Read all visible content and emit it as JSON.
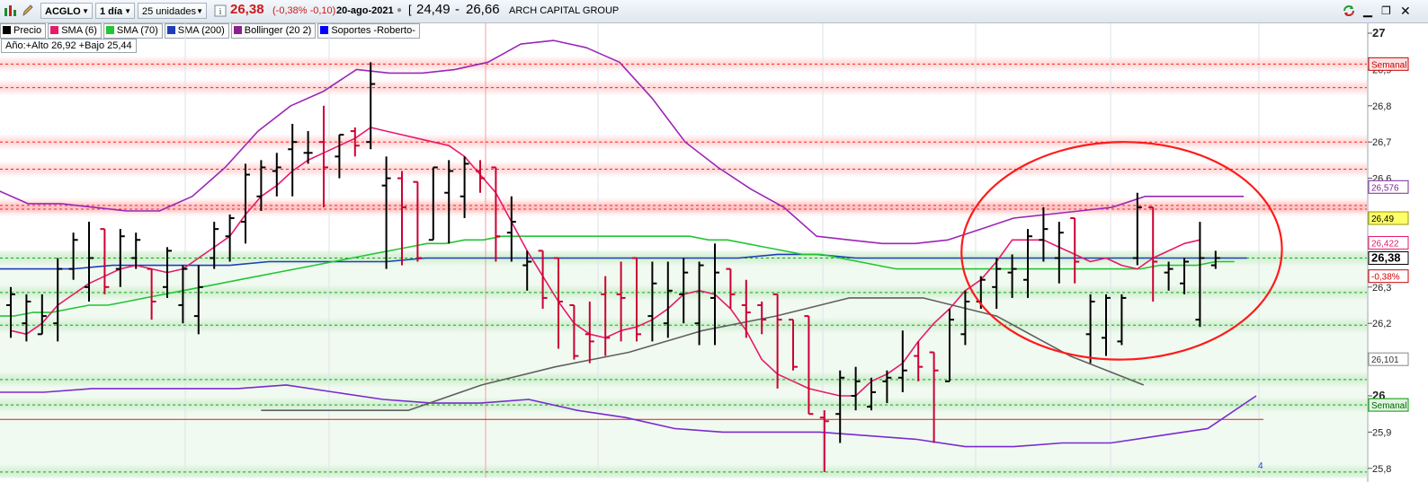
{
  "toolbar": {
    "symbol": "ACGLO",
    "interval": "1 día",
    "units": "25 unidades",
    "info_icon": "info-icon",
    "last_price": "26,38",
    "change": "(-0,38% -0,10)",
    "date": "20-ago-2021",
    "range_open": "[",
    "range_low": "24,49",
    "range_sep": "-",
    "range_high": "26,66",
    "company": "ARCH CAPITAL GROUP",
    "icons": [
      "bar-chart-icon",
      "refresh-icon",
      "minimize-icon",
      "restore-icon",
      "close-icon"
    ]
  },
  "legend": [
    {
      "label": "Precio",
      "color": "#000000"
    },
    {
      "label": "SMA (6)",
      "color": "#e8196a"
    },
    {
      "label": "SMA (70)",
      "color": "#22c534"
    },
    {
      "label": "SMA (200)",
      "color": "#1f3db8"
    },
    {
      "label": "Bollinger (20 2)",
      "color": "#8e1f8e"
    },
    {
      "label": "Soportes -Roberto-",
      "color": "#0000ff"
    }
  ],
  "year_range": "Año:+Alto 26,92 +Bajo 25,44",
  "axis_labels": [
    {
      "value": 27.0,
      "text": "27",
      "bold": true
    },
    {
      "value": 26.9,
      "text": "26,9"
    },
    {
      "value": 26.8,
      "text": "26,8"
    },
    {
      "value": 26.7,
      "text": "26,7"
    },
    {
      "value": 26.6,
      "text": "26,6"
    },
    {
      "value": 26.3,
      "text": "26,3"
    },
    {
      "value": 26.2,
      "text": "26,2"
    },
    {
      "value": 26.0,
      "text": "26",
      "bold": true
    },
    {
      "value": 25.9,
      "text": "25,9"
    },
    {
      "value": 25.8,
      "text": "25,8"
    }
  ],
  "axis_tags": [
    {
      "value": 26.915,
      "text": "Semanal",
      "fg": "#cc0000",
      "bg": "#fbe3e3",
      "border": "#cc0000"
    },
    {
      "value": 26.576,
      "text": "26,576",
      "fg": "#7a2a9a",
      "bg": "#ffffff",
      "border": "#7a2a9a"
    },
    {
      "value": 26.49,
      "text": "26,49",
      "fg": "#000000",
      "bg": "#ffff66",
      "border": "#999900"
    },
    {
      "value": 26.422,
      "text": "26,422",
      "fg": "#e8196a",
      "bg": "#ffffff",
      "border": "#e8196a"
    },
    {
      "value": 26.38,
      "text": "26,38",
      "fg": "#000000",
      "bg": "#ffffff",
      "border": "#000000",
      "bold": true
    },
    {
      "value": 26.33,
      "text": "-0,38%",
      "fg": "#cc0000",
      "bg": "#ffffff",
      "border": "#cc0000"
    },
    {
      "value": 26.101,
      "text": "26,101",
      "fg": "#333333",
      "bg": "#ffffff",
      "border": "#888888"
    },
    {
      "value": 25.975,
      "text": "Semanal",
      "fg": "#006600",
      "bg": "#dff5df",
      "border": "#009900"
    }
  ],
  "page_marker": "4",
  "colors": {
    "bull": "#000000",
    "bear": "#cc0033",
    "sma6": "#e8196a",
    "sma70": "#22c534",
    "sma200": "#1f3db8",
    "boll_upper": "#9b26b6",
    "boll_lower": "#7a2ad0",
    "boll_mid": "#606060",
    "resistance": "#ff2222",
    "support": "#11aa11",
    "circle": "#ff1a1a"
  },
  "chart_data": {
    "type": "ohlc",
    "ylim": [
      25.78,
      27.02
    ],
    "resistance_levels": [
      26.915,
      26.85,
      26.7,
      26.625,
      26.525,
      26.515
    ],
    "support_levels": [
      26.38,
      26.285,
      26.195,
      26.045,
      25.975,
      25.79
    ],
    "red_line_level": 25.935,
    "bars": [
      {
        "o": 26.25,
        "h": 26.3,
        "l": 26.16,
        "c": 26.28
      },
      {
        "o": 26.2,
        "h": 26.28,
        "l": 26.15,
        "c": 26.26
      },
      {
        "o": 26.17,
        "h": 26.28,
        "l": 26.17,
        "c": 26.22
      },
      {
        "o": 26.2,
        "h": 26.38,
        "l": 26.15,
        "c": 26.35
      },
      {
        "o": 26.35,
        "h": 26.45,
        "l": 26.32,
        "c": 26.43
      },
      {
        "o": 26.3,
        "h": 26.48,
        "l": 26.26,
        "c": 26.38
      },
      {
        "o": 26.46,
        "h": 26.46,
        "l": 26.28,
        "c": 26.3
      },
      {
        "o": 26.35,
        "h": 26.46,
        "l": 26.3,
        "c": 26.44
      },
      {
        "o": 26.38,
        "h": 26.45,
        "l": 26.35,
        "c": 26.43
      },
      {
        "o": 26.35,
        "h": 26.35,
        "l": 26.21,
        "c": 26.26
      },
      {
        "o": 26.3,
        "h": 26.41,
        "l": 26.27,
        "c": 26.4
      },
      {
        "o": 26.25,
        "h": 26.36,
        "l": 26.2,
        "c": 26.35
      },
      {
        "o": 26.22,
        "h": 26.36,
        "l": 26.17,
        "c": 26.3
      },
      {
        "o": 26.38,
        "h": 26.48,
        "l": 26.35,
        "c": 26.46
      },
      {
        "o": 26.44,
        "h": 26.5,
        "l": 26.37,
        "c": 26.49
      },
      {
        "o": 26.48,
        "h": 26.64,
        "l": 26.42,
        "c": 26.61
      },
      {
        "o": 26.55,
        "h": 26.65,
        "l": 26.51,
        "c": 26.63
      },
      {
        "o": 26.62,
        "h": 26.67,
        "l": 26.55,
        "c": 26.63
      },
      {
        "o": 26.68,
        "h": 26.75,
        "l": 26.55,
        "c": 26.7
      },
      {
        "o": 26.67,
        "h": 26.73,
        "l": 26.64,
        "c": 26.67
      },
      {
        "o": 26.7,
        "h": 26.8,
        "l": 26.52,
        "c": 26.63
      },
      {
        "o": 26.66,
        "h": 26.72,
        "l": 26.6,
        "c": 26.72
      },
      {
        "o": 26.73,
        "h": 26.74,
        "l": 26.66,
        "c": 26.69
      },
      {
        "o": 26.7,
        "h": 26.92,
        "l": 26.68,
        "c": 26.86
      },
      {
        "o": 26.58,
        "h": 26.66,
        "l": 26.35,
        "c": 26.6
      },
      {
        "o": 26.6,
        "h": 26.62,
        "l": 26.36,
        "c": 26.52
      },
      {
        "o": 26.59,
        "h": 26.59,
        "l": 26.37,
        "c": 26.38
      },
      {
        "o": 26.43,
        "h": 26.63,
        "l": 26.43,
        "c": 26.63
      },
      {
        "o": 26.56,
        "h": 26.65,
        "l": 26.42,
        "c": 26.62
      },
      {
        "o": 26.55,
        "h": 26.66,
        "l": 26.49,
        "c": 26.64
      },
      {
        "o": 26.62,
        "h": 26.65,
        "l": 26.56,
        "c": 26.6
      },
      {
        "o": 26.63,
        "h": 26.63,
        "l": 26.37,
        "c": 26.44
      },
      {
        "o": 26.45,
        "h": 26.55,
        "l": 26.37,
        "c": 26.48
      },
      {
        "o": 26.36,
        "h": 26.4,
        "l": 26.29,
        "c": 26.37
      },
      {
        "o": 26.4,
        "h": 26.4,
        "l": 26.24,
        "c": 26.27
      },
      {
        "o": 26.38,
        "h": 26.38,
        "l": 26.13,
        "c": 26.26
      },
      {
        "o": 26.25,
        "h": 26.25,
        "l": 26.1,
        "c": 26.11
      },
      {
        "o": 26.17,
        "h": 26.26,
        "l": 26.09,
        "c": 26.15
      },
      {
        "o": 26.28,
        "h": 26.33,
        "l": 26.11,
        "c": 26.16
      },
      {
        "o": 26.28,
        "h": 26.37,
        "l": 26.15,
        "c": 26.27
      },
      {
        "o": 26.38,
        "h": 26.38,
        "l": 26.15,
        "c": 26.17
      },
      {
        "o": 26.22,
        "h": 26.37,
        "l": 26.15,
        "c": 26.31
      },
      {
        "o": 26.2,
        "h": 26.37,
        "l": 26.16,
        "c": 26.29
      },
      {
        "o": 26.28,
        "h": 26.38,
        "l": 26.2,
        "c": 26.34
      },
      {
        "o": 26.2,
        "h": 26.37,
        "l": 26.14,
        "c": 26.36
      },
      {
        "o": 26.27,
        "h": 26.42,
        "l": 26.14,
        "c": 26.34
      },
      {
        "o": 26.35,
        "h": 26.35,
        "l": 26.24,
        "c": 26.28
      },
      {
        "o": 26.25,
        "h": 26.32,
        "l": 26.16,
        "c": 26.23
      },
      {
        "o": 26.25,
        "h": 26.26,
        "l": 26.17,
        "c": 26.21
      },
      {
        "o": 26.28,
        "h": 26.28,
        "l": 26.02,
        "c": 26.21
      },
      {
        "o": 26.21,
        "h": 26.21,
        "l": 26.07,
        "c": 26.08
      },
      {
        "o": 26.22,
        "h": 26.22,
        "l": 25.95,
        "c": 25.95
      },
      {
        "o": 25.94,
        "h": 25.96,
        "l": 25.79,
        "c": 25.93
      },
      {
        "o": 25.95,
        "h": 26.07,
        "l": 25.87,
        "c": 26.05
      },
      {
        "o": 26.0,
        "h": 26.08,
        "l": 25.96,
        "c": 26.04
      },
      {
        "o": 25.97,
        "h": 26.05,
        "l": 25.96,
        "c": 26.01
      },
      {
        "o": 26.04,
        "h": 26.07,
        "l": 25.98,
        "c": 26.05
      },
      {
        "o": 26.05,
        "h": 26.18,
        "l": 26.01,
        "c": 26.07
      },
      {
        "o": 26.11,
        "h": 26.15,
        "l": 26.04,
        "c": 26.08
      },
      {
        "o": 26.12,
        "h": 26.12,
        "l": 25.87,
        "c": 26.07
      },
      {
        "o": 26.04,
        "h": 26.24,
        "l": 26.04,
        "c": 26.21
      },
      {
        "o": 26.17,
        "h": 26.29,
        "l": 26.14,
        "c": 26.26
      },
      {
        "o": 26.26,
        "h": 26.33,
        "l": 26.24,
        "c": 26.32
      },
      {
        "o": 26.3,
        "h": 26.38,
        "l": 26.24,
        "c": 26.35
      },
      {
        "o": 26.34,
        "h": 26.39,
        "l": 26.27,
        "c": 26.35
      },
      {
        "o": 26.32,
        "h": 26.46,
        "l": 26.27,
        "c": 26.44
      },
      {
        "o": 26.43,
        "h": 26.52,
        "l": 26.37,
        "c": 26.46
      },
      {
        "o": 26.38,
        "h": 26.48,
        "l": 26.31,
        "c": 26.45
      },
      {
        "o": 26.49,
        "h": 26.49,
        "l": 26.31,
        "c": 26.37
      },
      {
        "o": 26.17,
        "h": 26.28,
        "l": 26.09,
        "c": 26.26
      },
      {
        "o": 26.16,
        "h": 26.28,
        "l": 26.11,
        "c": 26.27
      },
      {
        "o": 26.15,
        "h": 26.28,
        "l": 26.14,
        "c": 26.27
      },
      {
        "o": 26.38,
        "h": 26.56,
        "l": 26.36,
        "c": 26.52
      },
      {
        "o": 26.52,
        "h": 26.52,
        "l": 26.26,
        "c": 26.37
      },
      {
        "o": 26.34,
        "h": 26.37,
        "l": 26.29,
        "c": 26.35
      },
      {
        "o": 26.31,
        "h": 26.38,
        "l": 26.28,
        "c": 26.37
      },
      {
        "o": 26.21,
        "h": 26.48,
        "l": 26.19,
        "c": 26.38
      },
      {
        "o": 26.36,
        "h": 26.4,
        "l": 26.35,
        "c": 26.38
      }
    ],
    "sma6": [
      26.18,
      26.17,
      26.2,
      26.25,
      26.28,
      26.31,
      26.33,
      26.35,
      26.36,
      26.35,
      26.34,
      26.35,
      26.38,
      26.41,
      26.44,
      26.5,
      26.55,
      26.58,
      26.62,
      26.65,
      26.67,
      26.69,
      26.71,
      26.74,
      26.73,
      26.72,
      26.71,
      26.7,
      26.69,
      26.66,
      26.61,
      26.56,
      26.48,
      26.4,
      26.33,
      26.26,
      26.2,
      26.17,
      26.16,
      26.18,
      26.19,
      26.21,
      26.24,
      26.28,
      26.29,
      26.28,
      26.24,
      26.18,
      26.1,
      26.06,
      26.04,
      26.02,
      26.01,
      26.0,
      26.0,
      26.04,
      26.06,
      26.09,
      26.15,
      26.2,
      26.24,
      26.29,
      26.32,
      26.37,
      26.43,
      26.43,
      26.43,
      26.41,
      26.39,
      26.37,
      26.38,
      26.36,
      26.35,
      26.38,
      26.4,
      26.42,
      26.43
    ],
    "sma70": [
      26.22,
      26.22,
      26.23,
      26.23,
      26.24,
      26.25,
      26.25,
      26.26,
      26.27,
      26.28,
      26.29,
      26.3,
      26.31,
      26.32,
      26.33,
      26.34,
      26.35,
      26.36,
      26.37,
      26.38,
      26.39,
      26.4,
      26.41,
      26.42,
      26.42,
      26.43,
      26.43,
      26.44,
      26.44,
      26.44,
      26.44,
      26.44,
      26.44,
      26.44,
      26.44,
      26.44,
      26.44,
      26.44,
      26.43,
      26.43,
      26.42,
      26.41,
      26.4,
      26.39,
      26.39,
      26.38,
      26.37,
      26.36,
      26.35,
      26.35,
      26.35,
      26.35,
      26.35,
      26.35,
      26.35,
      26.35,
      26.35,
      26.35,
      26.35,
      26.35,
      26.35,
      26.35,
      26.36,
      26.36,
      26.36,
      26.37,
      26.37
    ],
    "sma200": [
      26.35,
      26.35,
      26.35,
      26.36,
      26.36,
      26.36,
      26.36,
      26.37,
      26.37,
      26.37,
      26.37,
      26.38,
      26.38,
      26.38,
      26.38,
      26.38,
      26.38,
      26.38,
      26.38,
      26.38,
      26.39,
      26.39,
      26.38,
      26.38,
      26.38,
      26.38,
      26.38,
      26.38,
      26.38,
      26.38,
      26.38,
      26.38,
      26.38
    ],
    "boll_upper": [
      26.57,
      26.53,
      26.53,
      26.52,
      26.51,
      26.51,
      26.55,
      26.63,
      26.73,
      26.8,
      26.84,
      26.9,
      26.89,
      26.89,
      26.9,
      26.92,
      26.97,
      26.98,
      26.96,
      26.92,
      26.82,
      26.7,
      26.63,
      26.57,
      26.52,
      26.44,
      26.43,
      26.42,
      26.42,
      26.43,
      26.46,
      26.49,
      26.5,
      26.51,
      26.52,
      26.55,
      26.55,
      26.55,
      26.55
    ],
    "boll_lower": [
      26.01,
      26.01,
      26.02,
      26.02,
      26.02,
      26.02,
      26.03,
      26.01,
      25.99,
      25.98,
      25.98,
      25.99,
      25.96,
      25.94,
      25.91,
      25.9,
      25.9,
      25.9,
      25.89,
      25.88,
      25.86,
      25.86,
      25.87,
      25.87,
      25.89,
      25.91,
      26.0
    ],
    "boll_mid": [
      25.96,
      25.96,
      25.96,
      26.03,
      26.08,
      26.12,
      26.18,
      26.22,
      26.27,
      26.27,
      26.22,
      26.11,
      26.03
    ],
    "circle": {
      "center_index": 71,
      "center_value": 26.4,
      "rx_bars": 6.4,
      "ry_value": 0.3
    }
  }
}
